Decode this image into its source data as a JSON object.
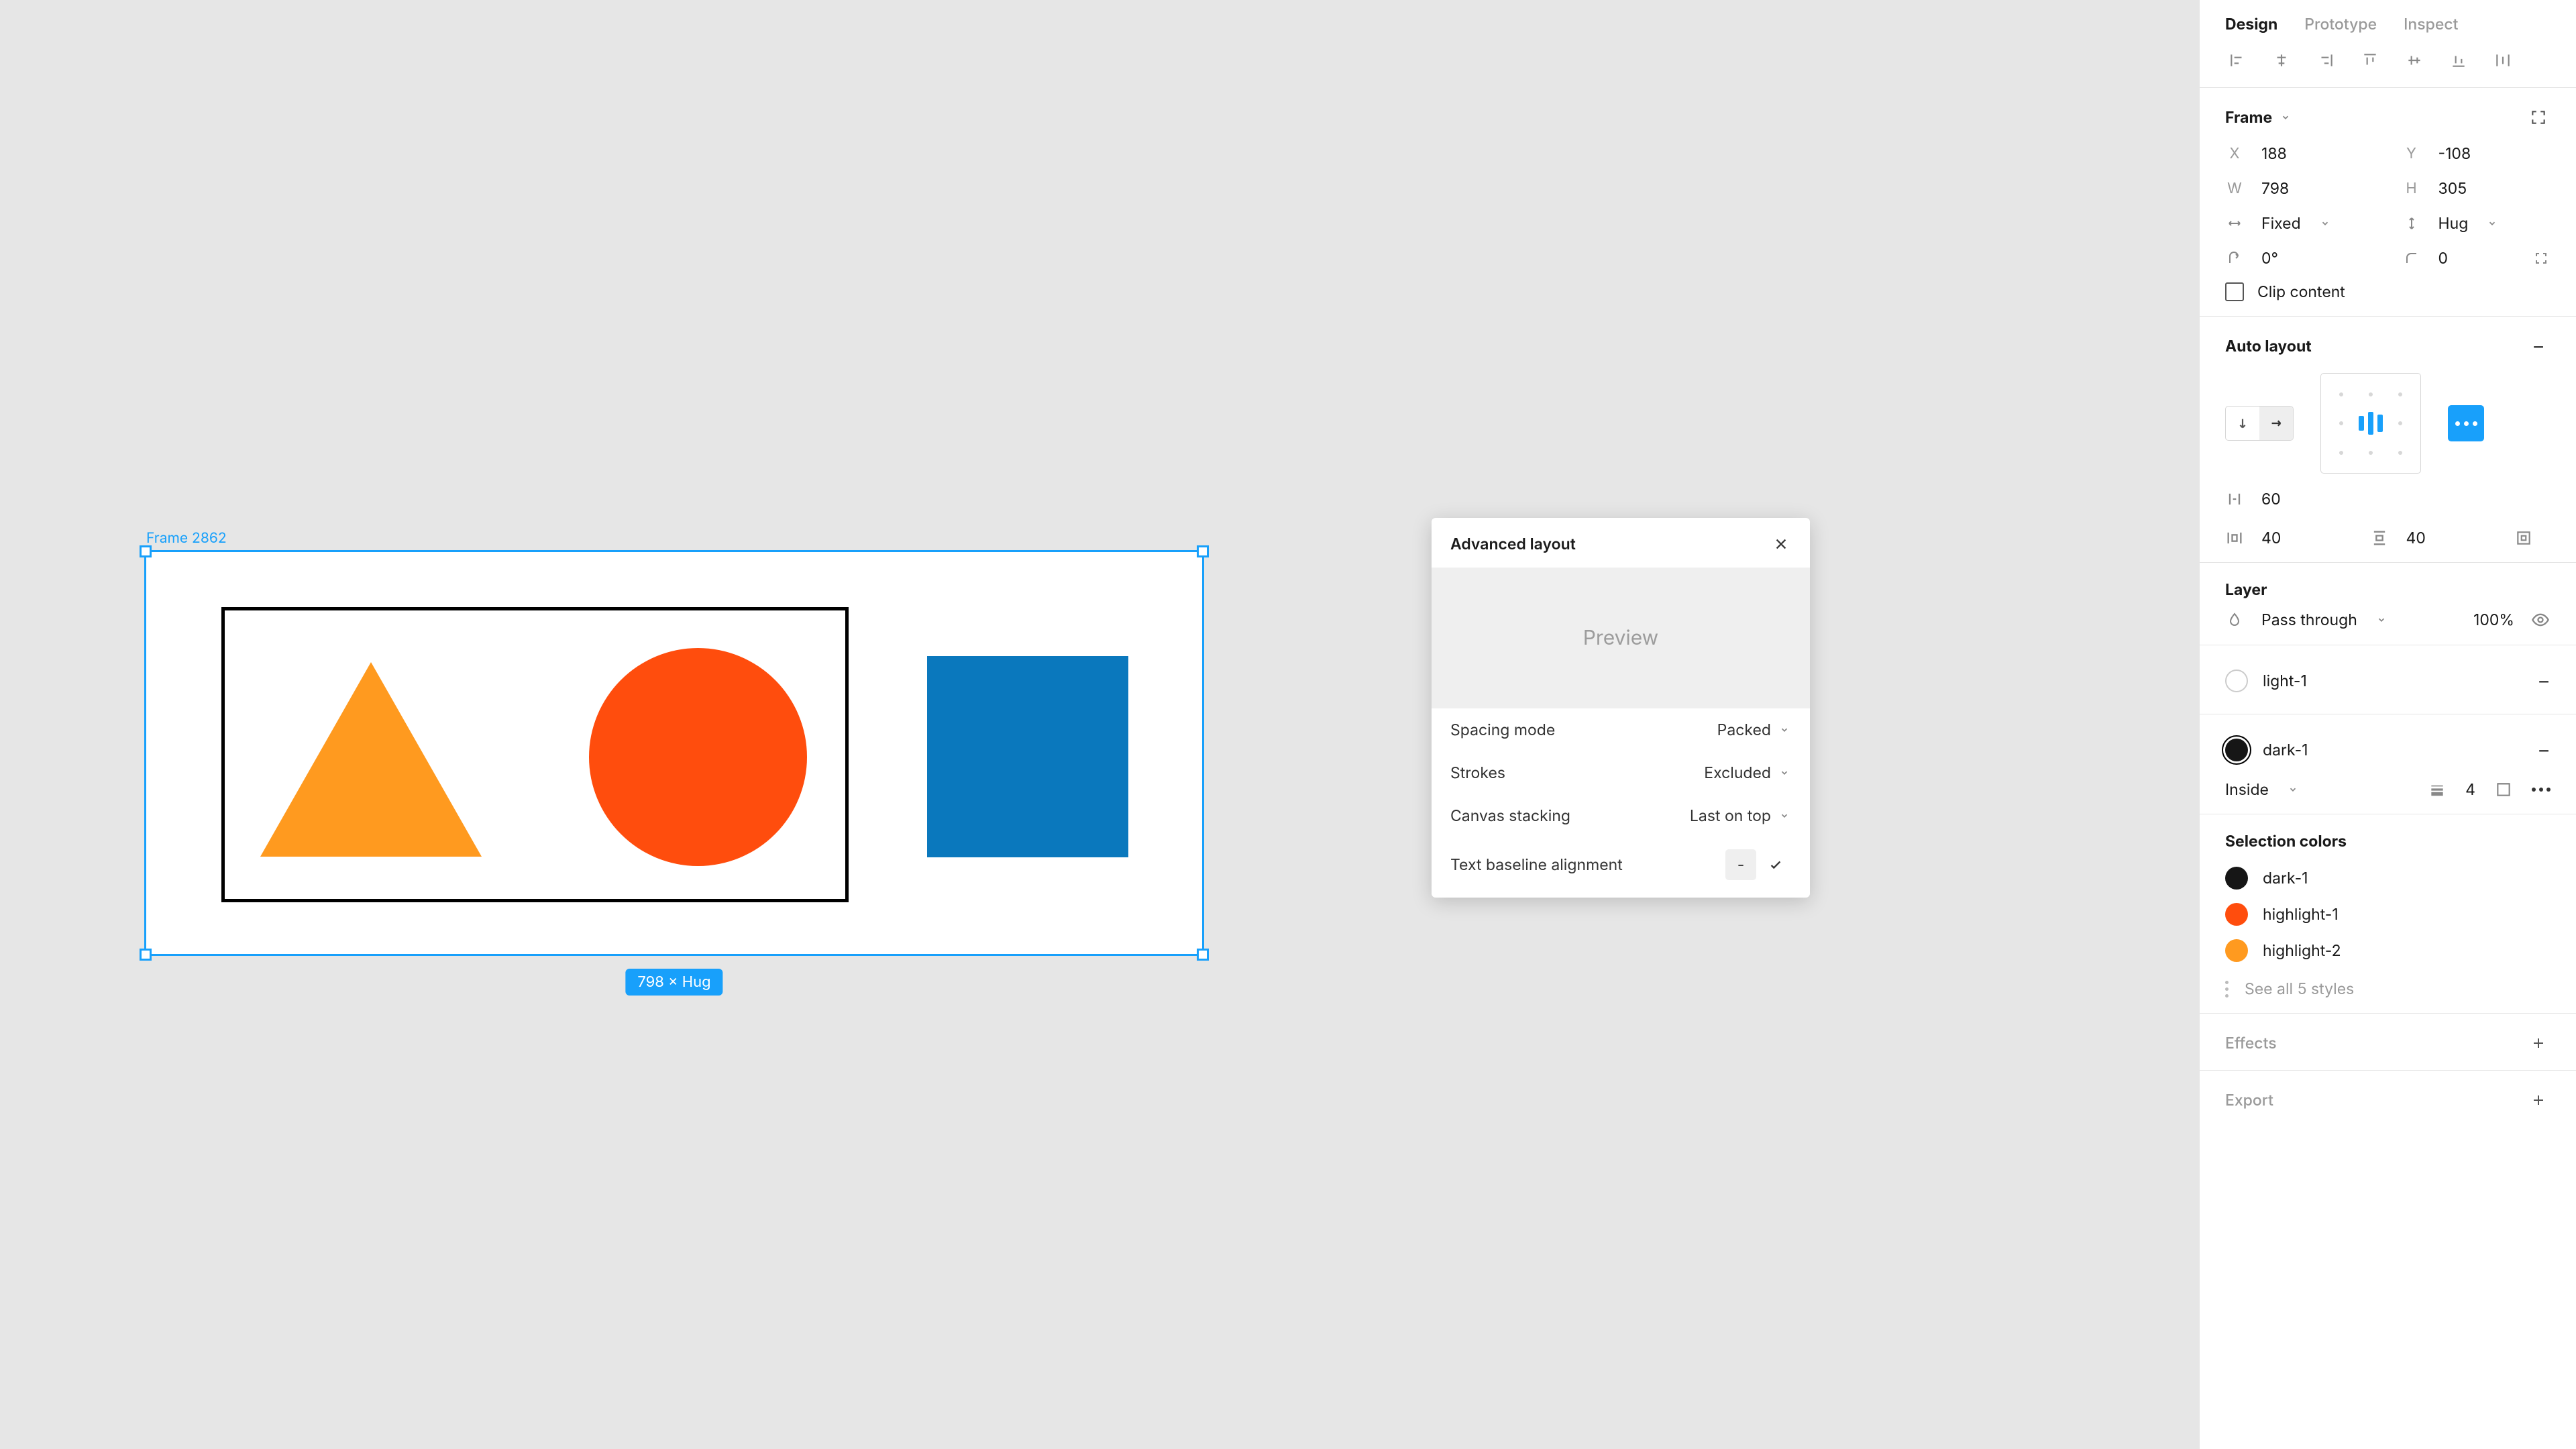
{
  "tabs": {
    "design": "Design",
    "prototype": "Prototype",
    "inspect": "Inspect"
  },
  "canvas": {
    "frame_name": "Frame 2862",
    "dimension_badge": "798 × Hug"
  },
  "frame_panel": {
    "title": "Frame",
    "x_label": "X",
    "x": "188",
    "y_label": "Y",
    "y": "-108",
    "w_label": "W",
    "w": "798",
    "h_label": "H",
    "h": "305",
    "h_resize": "Fixed",
    "v_resize": "Hug",
    "rotation": "0°",
    "corner_radius": "0",
    "clip_label": "Clip content"
  },
  "auto_layout": {
    "title": "Auto layout",
    "gap": "60",
    "pad_h": "40",
    "pad_v": "40"
  },
  "advanced": {
    "title": "Advanced layout",
    "preview": "Preview",
    "spacing_mode_label": "Spacing mode",
    "spacing_mode": "Packed",
    "strokes_label": "Strokes",
    "strokes": "Excluded",
    "canvas_stack_label": "Canvas stacking",
    "canvas_stack": "Last on top",
    "baseline_label": "Text baseline alignment",
    "baseline_off": "-"
  },
  "layer": {
    "title": "Layer",
    "blend": "Pass through",
    "opacity": "100%"
  },
  "fill": {
    "name": "light-1"
  },
  "stroke": {
    "name": "dark-1",
    "align": "Inside",
    "weight": "4"
  },
  "selection_colors": {
    "title": "Selection colors",
    "c1": "dark-1",
    "c2": "highlight-1",
    "c3": "highlight-2",
    "see_all": "See all 5 styles"
  },
  "effects": {
    "title": "Effects"
  },
  "export_panel": {
    "title": "Export"
  }
}
